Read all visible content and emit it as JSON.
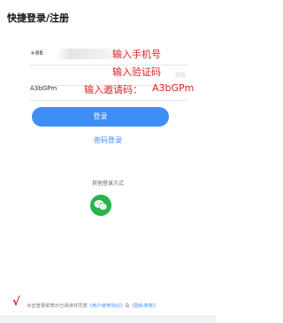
{
  "page": {
    "title": "快捷登录/注册"
  },
  "phone": {
    "prefix": "+86",
    "placeholder_faint": ""
  },
  "code": {
    "faint": "获取"
  },
  "invite": {
    "value": "A3bGPm"
  },
  "annotations": {
    "phone": "输入手机号",
    "code": "输入验证码",
    "invite_label": "输入邀请码：",
    "invite_code": "A3bGPm"
  },
  "login_button": "登录",
  "password_login": "密码登录",
  "other_login": "其他登录方式",
  "wechat": {
    "icon": "wechat-icon",
    "color": "#28b44a"
  },
  "agreement": {
    "check": "√",
    "prefix": "点击登录即表示已阅读并同意",
    "user_agreement": "《用户使用协议》",
    "and": "及",
    "privacy": "《隐私条款》"
  },
  "colors": {
    "accent": "#3e8ef7",
    "annotation": "#e02020"
  }
}
